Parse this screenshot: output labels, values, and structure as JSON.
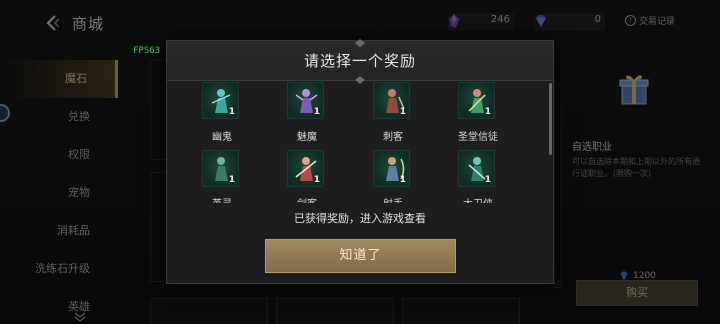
{
  "shop": {
    "title": "商城",
    "currency1_amount": "246",
    "currency2_amount": "0",
    "records_label": "交易记录",
    "records_icon": "!"
  },
  "fps_label": "FPS63",
  "sidebar": {
    "items": [
      {
        "label": "魔石",
        "active": true
      },
      {
        "label": "兑换"
      },
      {
        "label": "权限"
      },
      {
        "label": "宠物"
      },
      {
        "label": "消耗品"
      },
      {
        "label": "洗练石升级"
      },
      {
        "label": "英雄"
      }
    ]
  },
  "right_panel": {
    "title": "自选职业",
    "description": "可以自选除本期和上期以外的所有通行证职业。（限购一次）",
    "price": "1200",
    "buy_label": "购买"
  },
  "modal": {
    "title": "请选择一个奖励",
    "rewards": [
      {
        "name": "幽鬼",
        "count": "1"
      },
      {
        "name": "魅魔",
        "count": "1"
      },
      {
        "name": "刺客",
        "count": "1"
      },
      {
        "name": "圣堂信徒",
        "count": "1"
      },
      {
        "name": "英灵",
        "count": "1"
      },
      {
        "name": "剑客",
        "count": "1"
      },
      {
        "name": "射手",
        "count": "1"
      },
      {
        "name": "大卫侠",
        "count": "1"
      }
    ],
    "obtained_text": "已获得奖励，进入游戏查看",
    "confirm_label": "知道了"
  },
  "colors": {
    "accent_gold": "#c7a868",
    "fps_green": "#36c63d",
    "icon_bg": "#0f2a22"
  }
}
